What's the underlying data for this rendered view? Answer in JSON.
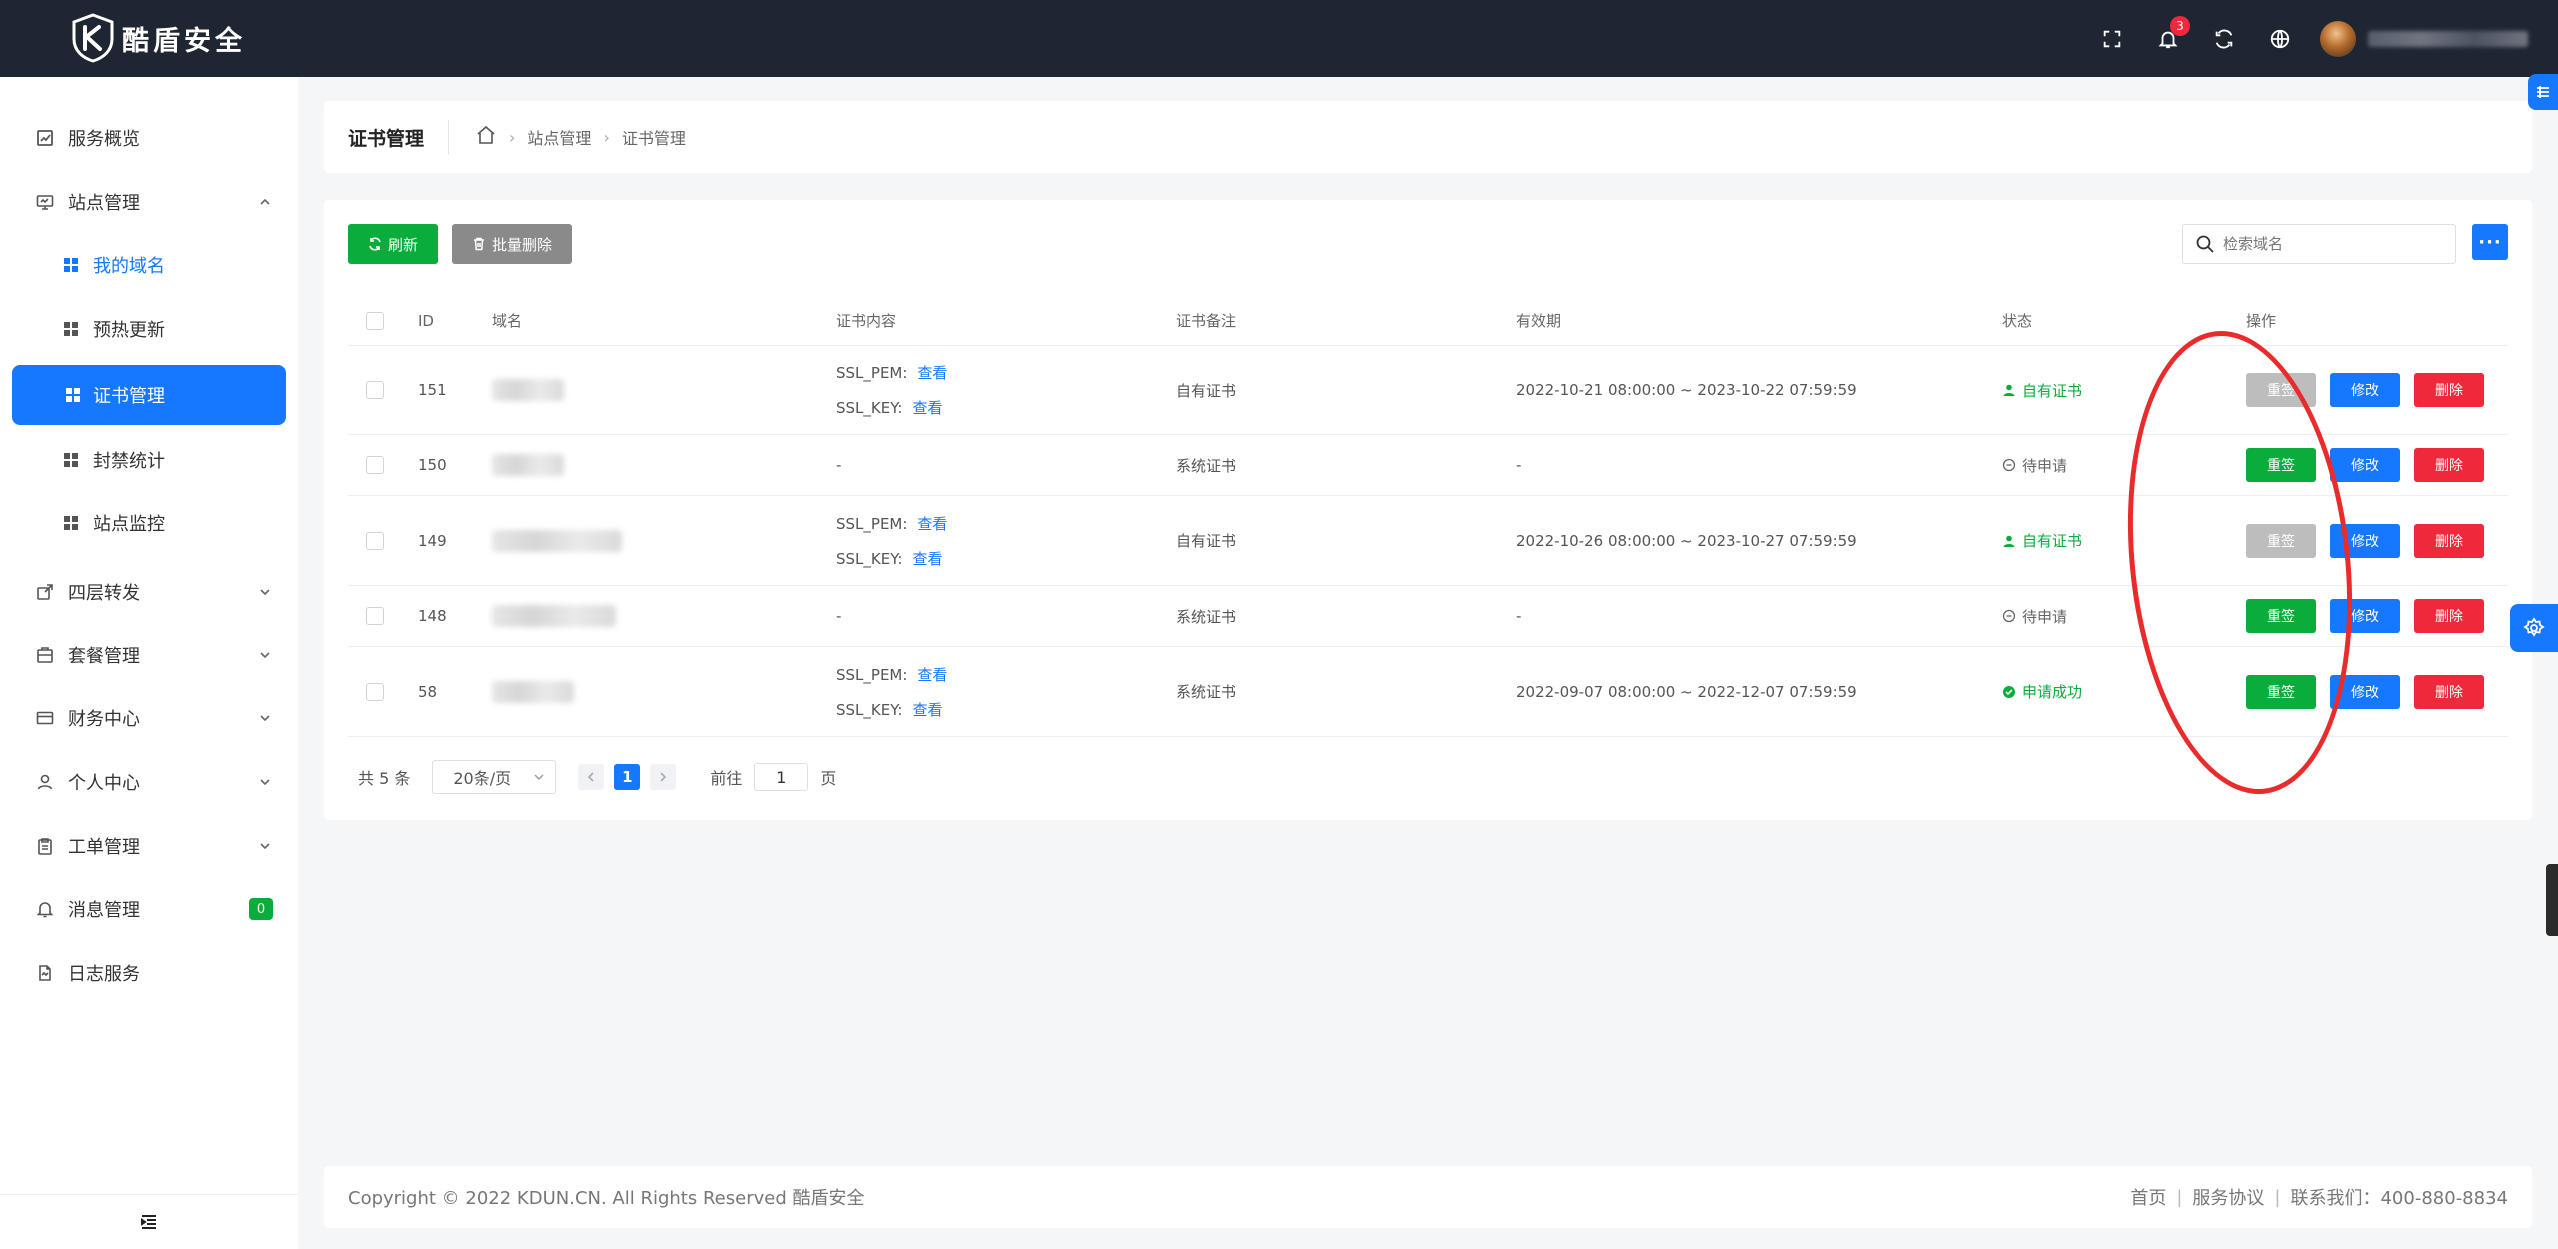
{
  "app": {
    "brand": "酷盾安全",
    "notification_count": "3"
  },
  "sidebar": {
    "items": [
      {
        "label": "服务概览",
        "icon": "chart-icon"
      },
      {
        "label": "站点管理",
        "icon": "monitor-icon",
        "expanded": true
      },
      {
        "label": "我的域名",
        "icon": "grid-icon",
        "sub": true,
        "current": true
      },
      {
        "label": "预热更新",
        "icon": "grid-icon",
        "sub": true
      },
      {
        "label": "证书管理",
        "icon": "grid-icon",
        "sub": true,
        "active": true
      },
      {
        "label": "封禁统计",
        "icon": "grid-icon",
        "sub": true
      },
      {
        "label": "站点监控",
        "icon": "grid-icon",
        "sub": true
      },
      {
        "label": "四层转发",
        "icon": "share-icon"
      },
      {
        "label": "套餐管理",
        "icon": "package-icon"
      },
      {
        "label": "财务中心",
        "icon": "card-icon"
      },
      {
        "label": "个人中心",
        "icon": "user-icon"
      },
      {
        "label": "工单管理",
        "icon": "clipboard-icon"
      },
      {
        "label": "消息管理",
        "icon": "bell-icon",
        "badge": "0"
      },
      {
        "label": "日志服务",
        "icon": "log-icon"
      }
    ]
  },
  "breadcrumb": {
    "title": "证书管理",
    "items": [
      "站点管理",
      "证书管理"
    ]
  },
  "toolbar": {
    "refresh_label": "刷新",
    "batch_delete_label": "批量删除",
    "search_placeholder": "检索域名",
    "more_label": "···"
  },
  "table": {
    "headers": {
      "id": "ID",
      "domain": "域名",
      "content": "证书内容",
      "note": "证书备注",
      "validity": "有效期",
      "status": "状态",
      "ops": "操作"
    },
    "pem_label": "SSL_PEM:",
    "key_label": "SSL_KEY:",
    "view_label": "查看",
    "op_resign": "重签",
    "op_edit": "修改",
    "op_delete": "删除",
    "rows": [
      {
        "id": "151",
        "has_cert": true,
        "note": "自有证书",
        "validity": "2022-10-21 08:00:00 ~ 2023-10-22 07:59:59",
        "status": "自有证书",
        "status_type": "own",
        "resign_disabled": true
      },
      {
        "id": "150",
        "has_cert": false,
        "content_dash": "-",
        "note": "系统证书",
        "validity": "-",
        "status": "待申请",
        "status_type": "pending",
        "resign_disabled": false
      },
      {
        "id": "149",
        "has_cert": true,
        "note": "自有证书",
        "validity": "2022-10-26 08:00:00 ~ 2023-10-27 07:59:59",
        "status": "自有证书",
        "status_type": "own",
        "resign_disabled": true
      },
      {
        "id": "148",
        "has_cert": false,
        "content_dash": "-",
        "note": "系统证书",
        "validity": "-",
        "status": "待申请",
        "status_type": "pending",
        "resign_disabled": false
      },
      {
        "id": "58",
        "has_cert": true,
        "note": "系统证书",
        "validity": "2022-09-07 08:00:00 ~ 2022-12-07 07:59:59",
        "status": "申请成功",
        "status_type": "success",
        "resign_disabled": false
      }
    ]
  },
  "pagination": {
    "total": "共 5 条",
    "page_size": "20条/页",
    "current_page": "1",
    "goto_label": "前往",
    "goto_value": "1",
    "goto_unit": "页"
  },
  "footer": {
    "copyright": "Copyright © 2022 KDUN.CN. All Rights Reserved 酷盾安全",
    "links": [
      "首页",
      "服务协议",
      "联系我们：400-880-8834"
    ]
  },
  "colors": {
    "primary": "#1677ff",
    "success": "#0aad3c",
    "danger": "#f0283c",
    "topbar": "#1f2633"
  }
}
